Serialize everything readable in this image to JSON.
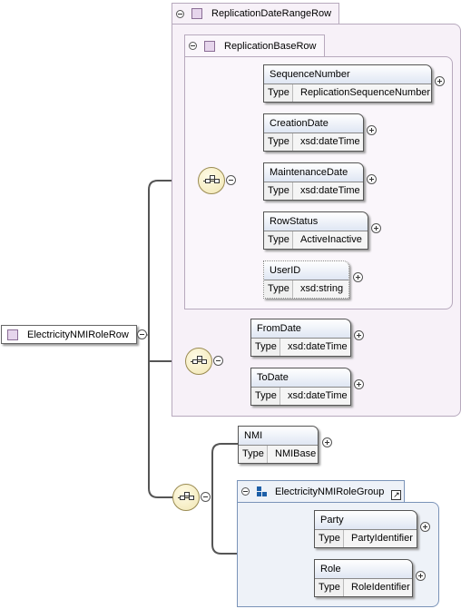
{
  "root": {
    "label": "ElectricityNMIRoleRow"
  },
  "type_label": "Type",
  "groups": {
    "date_range": {
      "label": "ReplicationDateRangeRow"
    },
    "base": {
      "label": "ReplicationBaseRow"
    },
    "role_group": {
      "label": "ElectricityNMIRoleGroup"
    }
  },
  "elements": {
    "sequence_number": {
      "name": "SequenceNumber",
      "type": "ReplicationSequenceNumber"
    },
    "creation_date": {
      "name": "CreationDate",
      "type": "xsd:dateTime"
    },
    "maintenance_date": {
      "name": "MaintenanceDate",
      "type": "xsd:dateTime"
    },
    "row_status": {
      "name": "RowStatus",
      "type": "ActiveInactive"
    },
    "user_id": {
      "name": "UserID",
      "type": "xsd:string"
    },
    "from_date": {
      "name": "FromDate",
      "type": "xsd:dateTime"
    },
    "to_date": {
      "name": "ToDate",
      "type": "xsd:dateTime"
    },
    "nmi": {
      "name": "NMI",
      "type": "NMIBase"
    },
    "party": {
      "name": "Party",
      "type": "PartyIdentifier"
    },
    "role": {
      "name": "Role",
      "type": "RoleIdentifier"
    }
  },
  "icons": [
    "collapse-icon",
    "expand-icon",
    "sequence-icon",
    "element-icon",
    "group-icon",
    "shortcut-arrow-icon"
  ]
}
